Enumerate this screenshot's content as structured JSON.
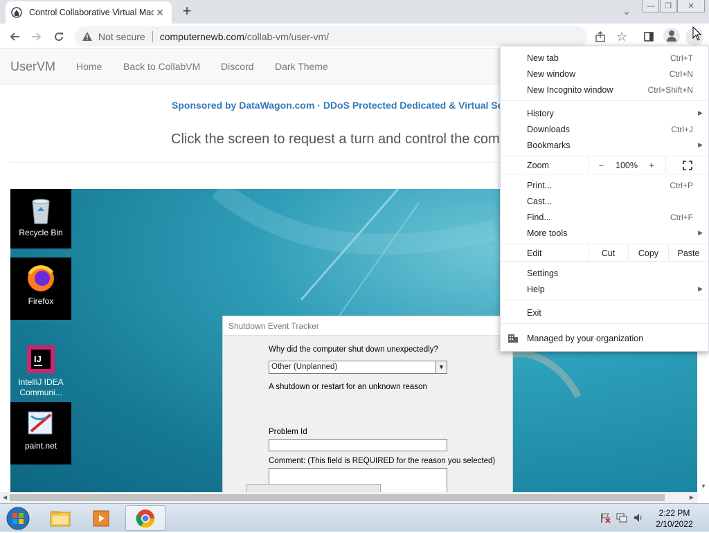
{
  "browser": {
    "tab_title": "Control Collaborative Virtual Machines",
    "security_label": "Not secure",
    "url_host": "computernewb.com",
    "url_path": "/collab-vm/user-vm/"
  },
  "navbar": {
    "brand": "UserVM",
    "links": [
      "Home",
      "Back to CollabVM",
      "Discord",
      "Dark Theme"
    ]
  },
  "page": {
    "sponsor_name": "Sponsored by DataWagon.com",
    "sponsor_separator": "·",
    "sponsor_tagline": "DDoS Protected Dedicated & Virtual Se",
    "instructions": "Click the screen to request a turn and control the comp"
  },
  "vm_desktop": {
    "icons": [
      {
        "label": "Recycle Bin"
      },
      {
        "label": "Firefox"
      },
      {
        "label": "IntelliJ IDEA Communi..."
      },
      {
        "label": "paint.net"
      }
    ],
    "dialog": {
      "title": "Shutdown Event Tracker",
      "question": "Why did the computer shut down unexpectedly?",
      "selected_reason": "Other (Unplanned)",
      "reason_description": "A shutdown or restart for an unknown reason",
      "problem_id_label": "Problem Id",
      "comment_label": "Comment: (This field is REQUIRED for the reason you selected)"
    }
  },
  "chrome_menu": {
    "new_tab": {
      "label": "New tab",
      "shortcut": "Ctrl+T"
    },
    "new_window": {
      "label": "New window",
      "shortcut": "Ctrl+N"
    },
    "new_incognito": {
      "label": "New Incognito window",
      "shortcut": "Ctrl+Shift+N"
    },
    "history": {
      "label": "History"
    },
    "downloads": {
      "label": "Downloads",
      "shortcut": "Ctrl+J"
    },
    "bookmarks": {
      "label": "Bookmarks"
    },
    "zoom": {
      "label": "Zoom",
      "minus": "−",
      "value": "100%",
      "plus": "+"
    },
    "print": {
      "label": "Print...",
      "shortcut": "Ctrl+P"
    },
    "cast": {
      "label": "Cast..."
    },
    "find": {
      "label": "Find...",
      "shortcut": "Ctrl+F"
    },
    "more_tools": {
      "label": "More tools"
    },
    "edit": {
      "label": "Edit",
      "cut": "Cut",
      "copy": "Copy",
      "paste": "Paste"
    },
    "settings": {
      "label": "Settings"
    },
    "help": {
      "label": "Help"
    },
    "exit": {
      "label": "Exit"
    },
    "managed": {
      "label": "Managed by your organization"
    }
  },
  "taskbar": {
    "time": "2:22 PM",
    "date": "2/10/2022"
  },
  "colors": {
    "link_blue": "#337ab7",
    "vm_teal": "#2f9db8",
    "taskbar": "#dfe8f1"
  }
}
